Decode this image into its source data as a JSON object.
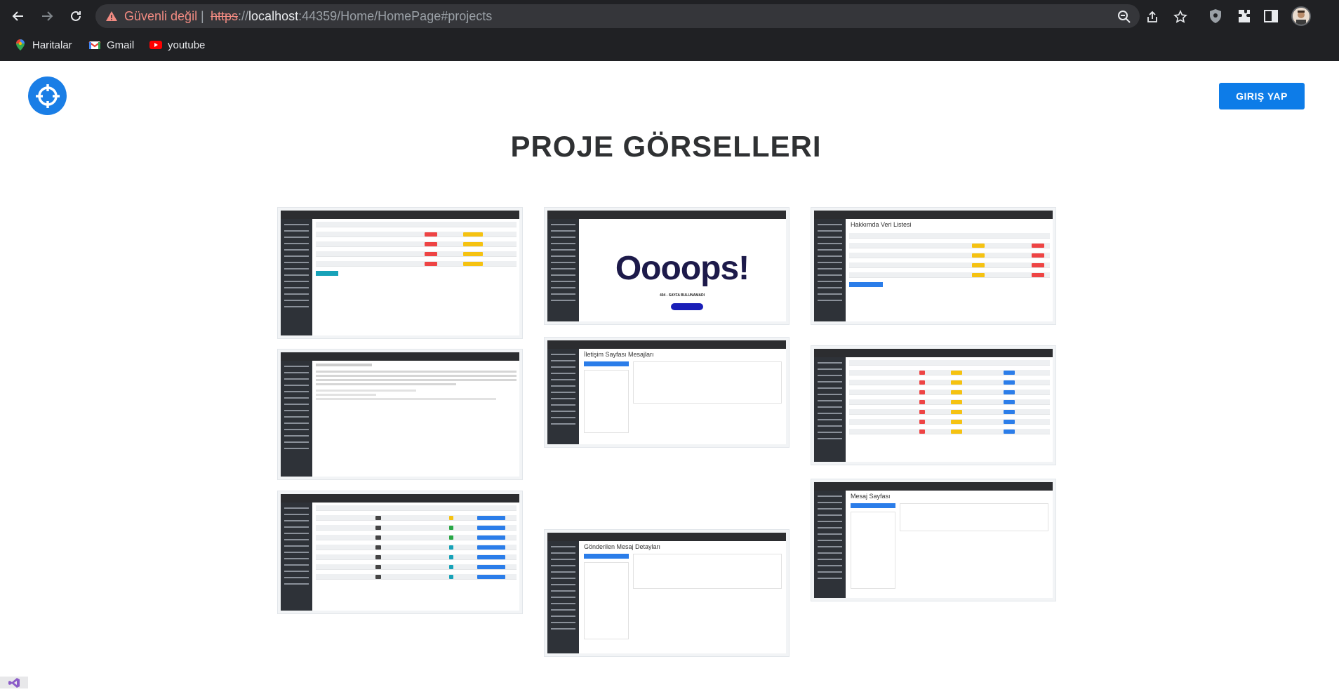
{
  "browser": {
    "security_label": "Güvenli değil",
    "separator": "|",
    "url_scheme": "https",
    "url_sep": "://",
    "url_host": "localhost",
    "url_rest": ":44359/Home/HomePage#projects",
    "bookmarks": [
      {
        "label": "Haritalar",
        "icon": "maps-icon"
      },
      {
        "label": "Gmail",
        "icon": "gmail-icon"
      },
      {
        "label": "youtube",
        "icon": "youtube-icon"
      }
    ]
  },
  "header": {
    "login_label": "GIRIŞ YAP"
  },
  "projects": {
    "title": "PROJE GÖRSELLERI",
    "oops_text": "Oooops!",
    "oops_subtitle": "404 - SAYFA BULUNAMADI",
    "thumb_titles": [
      "Hakkımda Veri Listesi",
      "İletişim Sayfası Mesajları",
      "Gönderilen Mesaj Detayları",
      "Mesaj Sayfası"
    ]
  },
  "colors": {
    "accent": "#0d7ce8",
    "logo_bg": "#1a7ee6",
    "title_text": "#2f3133",
    "chrome_bg": "#202124",
    "insecure_red": "#f28b82"
  }
}
